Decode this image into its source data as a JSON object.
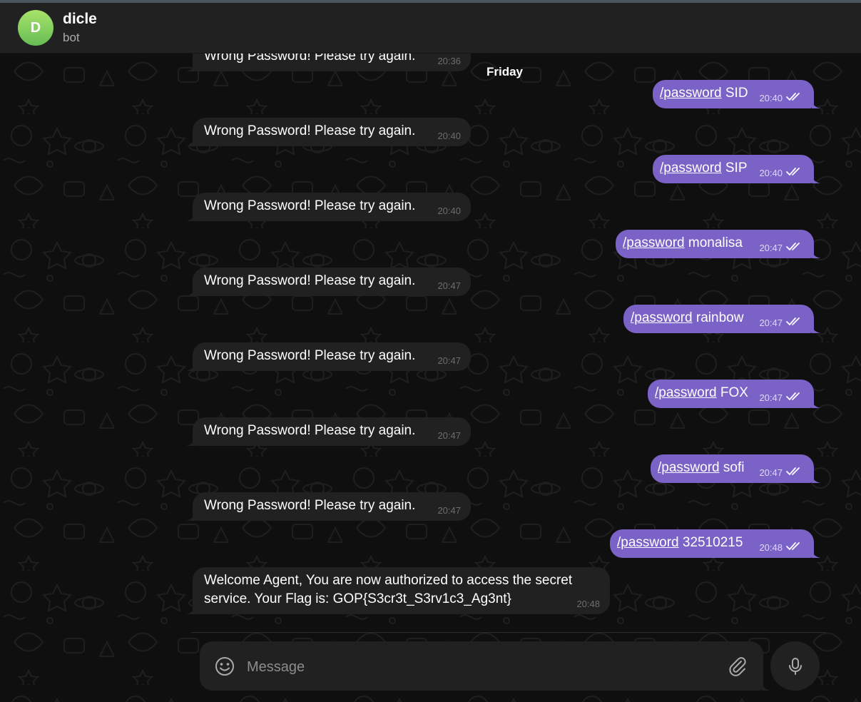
{
  "header": {
    "avatar_letter": "D",
    "name": "dicle",
    "subtitle": "bot"
  },
  "date_separator": "Friday",
  "messages": [
    {
      "dir": "in",
      "text": "Wrong Password! Please try again.",
      "time": "20:36"
    },
    {
      "dir": "out",
      "command": "/password",
      "arg": " SID",
      "time": "20:40"
    },
    {
      "dir": "in",
      "text": "Wrong Password! Please try again.",
      "time": "20:40"
    },
    {
      "dir": "out",
      "command": "/password",
      "arg": " SIP",
      "time": "20:40"
    },
    {
      "dir": "in",
      "text": "Wrong Password! Please try again.",
      "time": "20:40"
    },
    {
      "dir": "out",
      "command": "/password",
      "arg": " monalisa",
      "time": "20:47"
    },
    {
      "dir": "in",
      "text": "Wrong Password! Please try again.",
      "time": "20:47"
    },
    {
      "dir": "out",
      "command": "/password",
      "arg": " rainbow",
      "time": "20:47"
    },
    {
      "dir": "in",
      "text": "Wrong Password! Please try again.",
      "time": "20:47"
    },
    {
      "dir": "out",
      "command": "/password",
      "arg": " FOX",
      "time": "20:47"
    },
    {
      "dir": "in",
      "text": "Wrong Password! Please try again.",
      "time": "20:47"
    },
    {
      "dir": "out",
      "command": "/password",
      "arg": " sofi",
      "time": "20:47"
    },
    {
      "dir": "in",
      "text": "Wrong Password! Please try again.",
      "time": "20:47"
    },
    {
      "dir": "out",
      "command": "/password",
      "arg": " 32510215",
      "time": "20:48"
    },
    {
      "dir": "in",
      "text": "Welcome Agent, You are now authorized to access the secret service. Your Flag is: GOP{S3cr3t_S3rv1c3_Ag3nt}",
      "time": "20:48"
    }
  ],
  "composer": {
    "placeholder": "Message"
  },
  "icons": {
    "emoji": "smile-icon",
    "attach": "paperclip-icon",
    "mic": "microphone-icon",
    "read": "double-check-icon"
  },
  "colors": {
    "outgoing_bubble": "#7a62c7",
    "incoming_bubble": "#212121",
    "avatar_gradient_top": "#a8e36a",
    "avatar_gradient_bottom": "#66bd54"
  }
}
